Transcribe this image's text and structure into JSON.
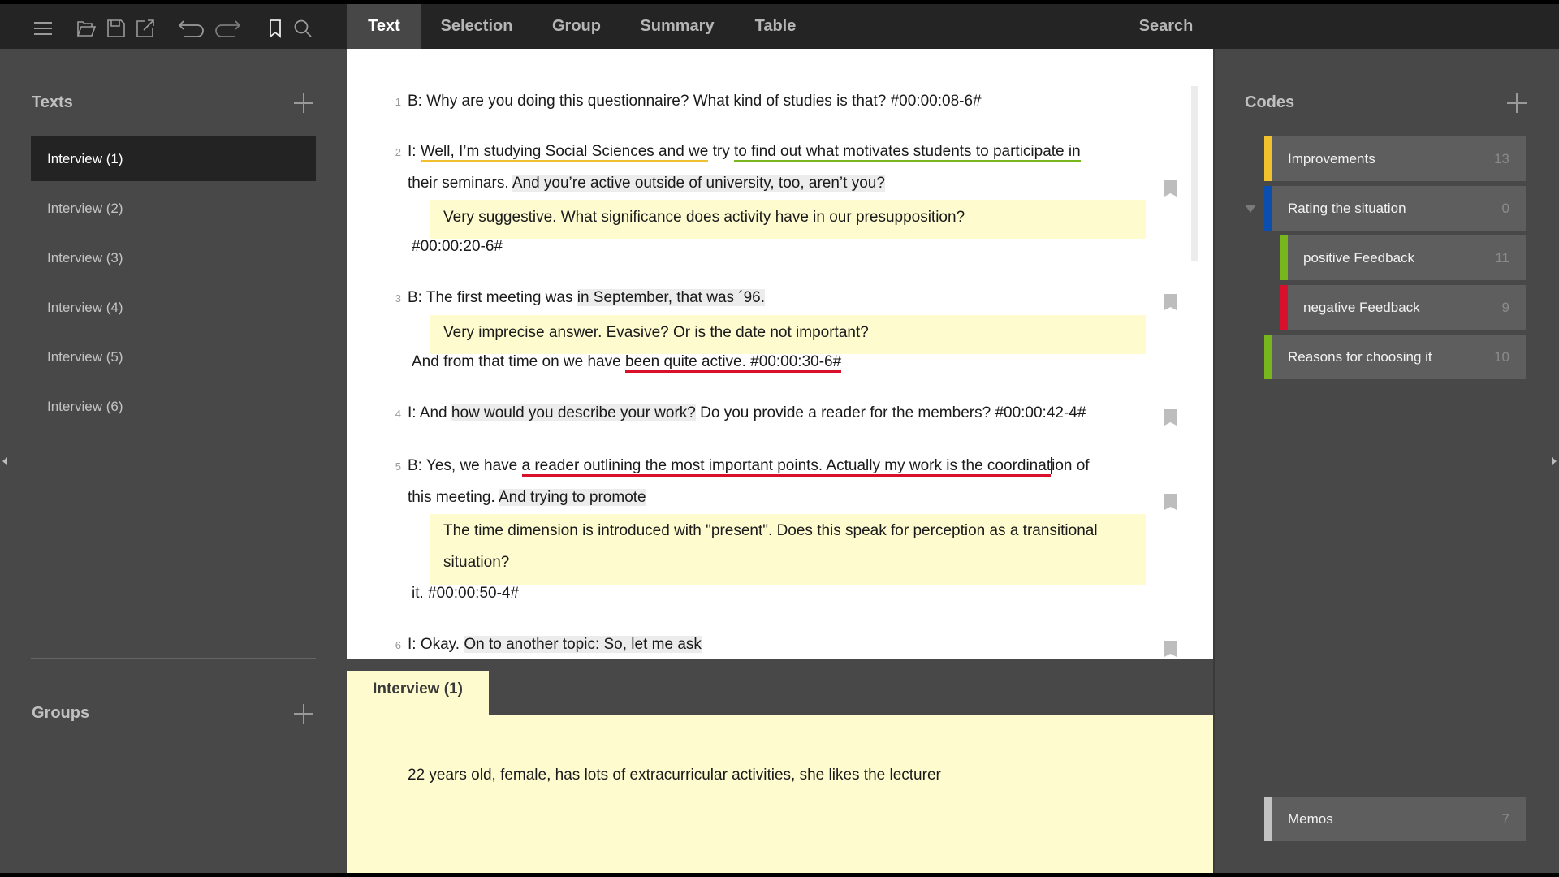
{
  "toolbar": {
    "icons": [
      "menu-icon",
      "folder-open-icon",
      "save-icon",
      "export-icon",
      "undo-icon",
      "redo-icon",
      "bookmark-icon",
      "search-icon"
    ],
    "tabs": [
      {
        "label": "Text",
        "active": true
      },
      {
        "label": "Selection",
        "active": false
      },
      {
        "label": "Group",
        "active": false
      },
      {
        "label": "Summary",
        "active": false
      },
      {
        "label": "Table",
        "active": false
      }
    ],
    "search_label": "Search"
  },
  "texts_panel": {
    "title": "Texts",
    "items": [
      {
        "label": "Interview (1)",
        "active": true
      },
      {
        "label": "Interview (2)",
        "active": false
      },
      {
        "label": "Interview (3)",
        "active": false
      },
      {
        "label": "Interview (4)",
        "active": false
      },
      {
        "label": "Interview (5)",
        "active": false
      },
      {
        "label": "Interview (6)",
        "active": false
      }
    ]
  },
  "groups_panel": {
    "title": "Groups"
  },
  "document": {
    "lines": [
      {
        "number": "1",
        "parts": [
          "B: Why are you doing this questionnaire? What kind of studies is that? #00:00:08-6#"
        ]
      },
      {
        "number": "2",
        "parts": [
          "I: ",
          "Well, I’m studying Social Sciences and we",
          " try ",
          "to find out what motivates students to participate in"
        ],
        "cont": [
          "their seminars. ",
          "And you’re active outside of university, too, aren’t you?"
        ],
        "memo": "Very suggestive. What significance does activity have in our presupposition?",
        "after": "#00:00:20-6#"
      },
      {
        "number": "3",
        "parts": [
          "B: The first meeting was ",
          "in September, that was ´96."
        ],
        "memo": "Very imprecise answer. Evasive? Or is the date not important?",
        "after": [
          "And from that time on we have ",
          "been quite active. #00:00:30-6#"
        ]
      },
      {
        "number": "4",
        "parts": [
          "I: And ",
          "how would you describe your work?",
          " Do you provide a reader for the members? #00:00:42-4#"
        ]
      },
      {
        "number": "5",
        "parts": [
          "B: Yes, we have ",
          "a reader outlining the most important points. Actually my work is the coordinat",
          "ion of"
        ],
        "cont": [
          "this meeting. ",
          "And trying to promote"
        ],
        "memo": [
          "The time dimension is introduced with \"present\". Does this speak for perception as a transitional",
          "situation?"
        ],
        "after": "it. #00:00:50-4#"
      },
      {
        "number": "6",
        "parts": [
          "I: Okay. ",
          "On to another topic: So, let me ask"
        ]
      }
    ]
  },
  "memo_pane": {
    "tab_label": "Interview (1)",
    "text": "22 years old, female, has lots of extracurricular activities, she likes the lecturer"
  },
  "codes_panel": {
    "title": "Codes",
    "codes": [
      {
        "label": "Improvements",
        "count": "13",
        "color": "#f2c12e"
      },
      {
        "label": "Rating the situation",
        "count": "0",
        "color": "#0a4fb0",
        "expanded": true
      },
      {
        "label": "positive Feedback",
        "count": "11",
        "color": "#78b61e",
        "child": true
      },
      {
        "label": "negative Feedback",
        "count": "9",
        "color": "#d8102c",
        "child": true
      },
      {
        "label": "Reasons for choosing it",
        "count": "10",
        "color": "#78b61e"
      }
    ],
    "memos": {
      "label": "Memos",
      "count": "7",
      "color": "#c2c2c2"
    }
  },
  "colors": {
    "memo_background": "#fefccf",
    "highlight": "#ececec",
    "code_yellow": "#f2c12e",
    "code_green": "#78b61e",
    "code_red": "#d8102c",
    "code_blue": "#0a4fb0"
  }
}
